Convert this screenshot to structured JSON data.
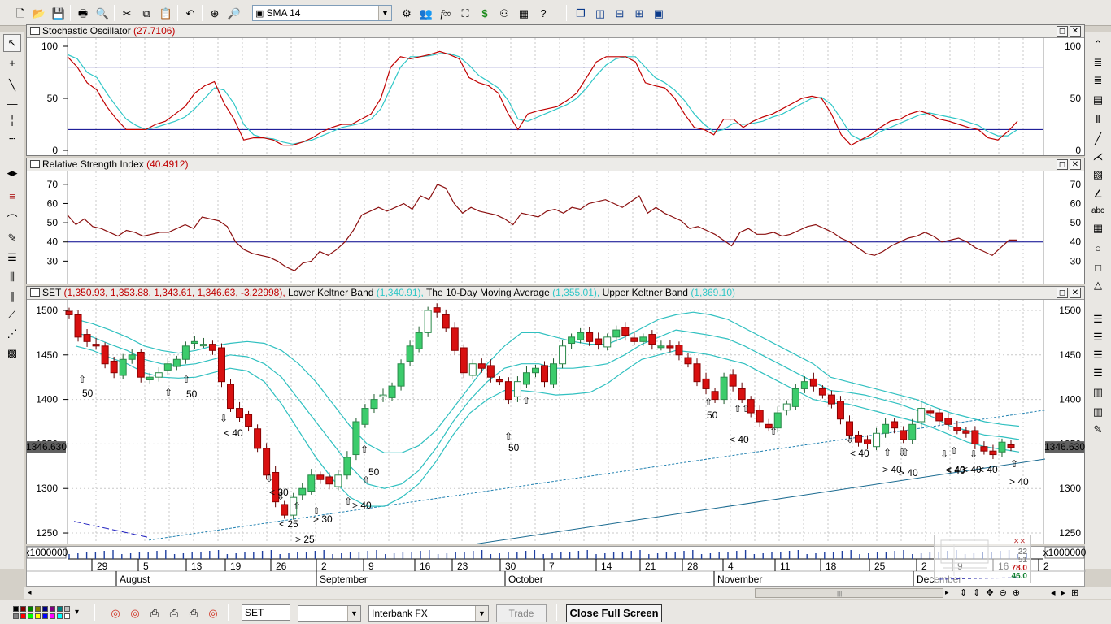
{
  "toolbar": {
    "indicator_select": "SMA 14",
    "buttons": [
      "new-file-icon",
      "open-folder-icon",
      "save-icon",
      "print-icon",
      "print-preview-icon",
      "cut-icon",
      "copy-icon",
      "paste-icon",
      "undo-icon",
      "crosshair-icon",
      "zoom-icon",
      "indicator-icon",
      "profile-icon",
      "formula-icon",
      "chart-icon",
      "dollar-icon",
      "binoculars-icon",
      "detail-icon",
      "help-icon",
      "cascade-icon",
      "tile-vertical-icon",
      "tile-horizontal-icon",
      "tile-icon",
      "layout-icon"
    ]
  },
  "panels": {
    "stochastic": {
      "title": "Stochastic Oscillator",
      "value": "(27.7106)",
      "axis_labels": [
        "100",
        "50",
        "0"
      ]
    },
    "rsi": {
      "title": "Relative Strength Index",
      "value": "(40.4912)",
      "axis_labels": [
        "70",
        "60",
        "50",
        "40",
        "30"
      ]
    },
    "price": {
      "title": "SET",
      "ohlc": "(1,350.93, 1,353.88, 1,343.61, 1,346.63, -3.22998),",
      "lower_label": "Lower Keltner Band",
      "lower_value": "(1,340.91),",
      "ma_label": "The 10-Day Moving Average",
      "ma_value": "(1,355.01),",
      "upper_label": "Upper Keltner Band",
      "upper_value": "(1,369.10)",
      "axis_labels": [
        "1500",
        "1450",
        "1400",
        "1350",
        "1300",
        "1250"
      ],
      "last_price": "1346.630",
      "signals": [
        "50",
        "50",
        "< 40",
        "< 30",
        "< 25",
        "> 25",
        "> 30",
        "> 40",
        "50",
        "50",
        "50",
        "< 40",
        "< 40",
        "< 40",
        "> 40",
        "> 40",
        "< 40",
        "< 40",
        "< 40",
        "> 40"
      ]
    },
    "volume": {
      "scale": "x1000000"
    }
  },
  "date_axis": {
    "days": [
      "29",
      "5",
      "13",
      "19",
      "26",
      "2",
      "9",
      "16",
      "23",
      "30",
      "7",
      "14",
      "21",
      "28",
      "4",
      "11",
      "18",
      "25",
      "2",
      "9",
      "16",
      "2"
    ],
    "months": [
      "August",
      "September",
      "October",
      "November",
      "December"
    ]
  },
  "minimap": {
    "values": [
      "22",
      "51",
      "78.0",
      "46.0"
    ]
  },
  "status": {
    "symbol": "SET",
    "period_select": "",
    "source_select": "Interbank FX",
    "trade_button": "Trade",
    "fullscreen_button": "Close Full Screen"
  },
  "colors": {
    "stoch_k": "#c00000",
    "stoch_d": "#2fc7c7",
    "rsi_line": "#8b1010",
    "up_candle": "#3ccc6c",
    "down_candle": "#d81010",
    "keltner": "#30c0c0",
    "threshold_line": "#00008b"
  },
  "chart_data": [
    {
      "type": "line",
      "title": "Stochastic Oscillator",
      "ylim": [
        0,
        100
      ],
      "reference_lines": [
        80,
        20
      ],
      "series": [
        {
          "name": "%K",
          "values": [
            90,
            80,
            65,
            58,
            42,
            30,
            20,
            20,
            20,
            25,
            28,
            35,
            42,
            55,
            62,
            66,
            45,
            30,
            10,
            12,
            12,
            10,
            5,
            5,
            8,
            12,
            18,
            22,
            25,
            25,
            30,
            35,
            50,
            80,
            90,
            88,
            90,
            92,
            95,
            92,
            88,
            70,
            65,
            62,
            55,
            35,
            20,
            35,
            38,
            40,
            42,
            48,
            55,
            70,
            85,
            90,
            90,
            90,
            85,
            65,
            62,
            60,
            50,
            35,
            22,
            20,
            15,
            30,
            30,
            22,
            28,
            32,
            35,
            40,
            45,
            50,
            52,
            50,
            35,
            15,
            5,
            10,
            15,
            22,
            28,
            30,
            35,
            38,
            35,
            30,
            28,
            25,
            22,
            20,
            12,
            10,
            18,
            28
          ]
        },
        {
          "name": "%D",
          "values": [
            92,
            88,
            75,
            70,
            55,
            42,
            30,
            24,
            20,
            22,
            25,
            28,
            32,
            40,
            50,
            60,
            58,
            45,
            25,
            15,
            12,
            11,
            8,
            6,
            8,
            10,
            14,
            18,
            22,
            24,
            26,
            30,
            40,
            60,
            80,
            90,
            90,
            91,
            93,
            93,
            90,
            82,
            72,
            66,
            60,
            48,
            30,
            28,
            32,
            36,
            40,
            44,
            50,
            60,
            72,
            82,
            88,
            90,
            90,
            80,
            70,
            65,
            58,
            48,
            35,
            25,
            18,
            20,
            26,
            25,
            26,
            28,
            32,
            35,
            40,
            45,
            50,
            51,
            44,
            30,
            15,
            10,
            12,
            18,
            22,
            26,
            30,
            34,
            36,
            34,
            32,
            30,
            27,
            24,
            18,
            14,
            14,
            20
          ]
        }
      ]
    },
    {
      "type": "line",
      "title": "Relative Strength Index",
      "ylim": [
        20,
        75
      ],
      "reference_lines": [
        40
      ],
      "series": [
        {
          "name": "RSI",
          "values": [
            54,
            49,
            52,
            48,
            47,
            45,
            43,
            46,
            45,
            43,
            44,
            45,
            45,
            47,
            49,
            47,
            53,
            52,
            51,
            48,
            40,
            36,
            34,
            33,
            32,
            30,
            27,
            25,
            29,
            30,
            35,
            33,
            36,
            40,
            46,
            54,
            56,
            58,
            56,
            58,
            60,
            57,
            64,
            62,
            70,
            68,
            60,
            55,
            58,
            56,
            55,
            54,
            52,
            49,
            55,
            54,
            53,
            56,
            57,
            55,
            58,
            57,
            60,
            61,
            62,
            60,
            58,
            61,
            64,
            55,
            58,
            55,
            53,
            51,
            47,
            48,
            46,
            44,
            41,
            38,
            45,
            47,
            44,
            44,
            45,
            43,
            44,
            46,
            48,
            49,
            47,
            45,
            42,
            40,
            37,
            34,
            33,
            35,
            38,
            40,
            42,
            43,
            45,
            43,
            40,
            41,
            42,
            40,
            37,
            35,
            33,
            37,
            41,
            41
          ]
        }
      ]
    },
    {
      "type": "candlestick",
      "title": "SET",
      "ylim": [
        1240,
        1510
      ],
      "series": [
        {
          "name": "Close",
          "values": [
            1495,
            1470,
            1465,
            1460,
            1440,
            1430,
            1445,
            1450,
            1425,
            1425,
            1430,
            1440,
            1445,
            1460,
            1465,
            1462,
            1455,
            1420,
            1390,
            1380,
            1370,
            1345,
            1315,
            1285,
            1270,
            1290,
            1300,
            1315,
            1310,
            1305,
            1315,
            1335,
            1375,
            1390,
            1400,
            1405,
            1415,
            1440,
            1460,
            1475,
            1500,
            1498,
            1480,
            1455,
            1430,
            1440,
            1435,
            1425,
            1420,
            1400,
            1420,
            1430,
            1435,
            1420,
            1440,
            1460,
            1470,
            1475,
            1465,
            1462,
            1470,
            1478,
            1472,
            1465,
            1470,
            1462,
            1460,
            1458,
            1450,
            1440,
            1420,
            1412,
            1400,
            1425,
            1415,
            1400,
            1385,
            1375,
            1368,
            1385,
            1395,
            1412,
            1420,
            1415,
            1405,
            1395,
            1378,
            1360,
            1352,
            1350,
            1362,
            1372,
            1368,
            1355,
            1372,
            1390,
            1385,
            1376,
            1372,
            1365,
            1362,
            1350,
            1342,
            1338,
            1352,
            1346
          ]
        },
        {
          "name": "Upper Keltner Band",
          "values": [
            1490,
            1485,
            1478,
            1470,
            1460,
            1455,
            1452,
            1455,
            1460,
            1463,
            1465,
            1463,
            1455,
            1440,
            1420,
            1395,
            1370,
            1350,
            1340,
            1340,
            1348,
            1365,
            1390,
            1415,
            1440,
            1460,
            1475,
            1475,
            1470,
            1465,
            1462,
            1462,
            1470,
            1480,
            1490,
            1495,
            1498,
            1495,
            1490,
            1480,
            1470,
            1460,
            1450,
            1440,
            1425,
            1420,
            1415,
            1410,
            1405,
            1400,
            1392,
            1385,
            1380,
            1375,
            1372,
            1370
          ]
        },
        {
          "name": "Moving Average",
          "values": [
            1475,
            1470,
            1462,
            1455,
            1445,
            1440,
            1438,
            1440,
            1445,
            1450,
            1448,
            1440,
            1425,
            1400,
            1375,
            1350,
            1325,
            1305,
            1300,
            1305,
            1320,
            1345,
            1375,
            1400,
            1420,
            1435,
            1440,
            1440,
            1435,
            1435,
            1437,
            1440,
            1450,
            1462,
            1470,
            1478,
            1475,
            1472,
            1468,
            1460,
            1450,
            1440,
            1430,
            1420,
            1410,
            1408,
            1405,
            1400,
            1395,
            1388,
            1380,
            1370,
            1365,
            1360,
            1358,
            1355
          ]
        },
        {
          "name": "Lower Keltner Band",
          "values": [
            1460,
            1455,
            1447,
            1440,
            1430,
            1425,
            1424,
            1425,
            1430,
            1435,
            1432,
            1420,
            1395,
            1365,
            1335,
            1310,
            1290,
            1280,
            1280,
            1290,
            1305,
            1330,
            1360,
            1385,
            1400,
            1410,
            1410,
            1408,
            1405,
            1406,
            1408,
            1418,
            1432,
            1445,
            1450,
            1455,
            1453,
            1450,
            1445,
            1440,
            1430,
            1420,
            1410,
            1400,
            1396,
            1395,
            1390,
            1385,
            1380,
            1375,
            1368,
            1360,
            1352,
            1347,
            1344,
            1341
          ]
        }
      ]
    }
  ]
}
